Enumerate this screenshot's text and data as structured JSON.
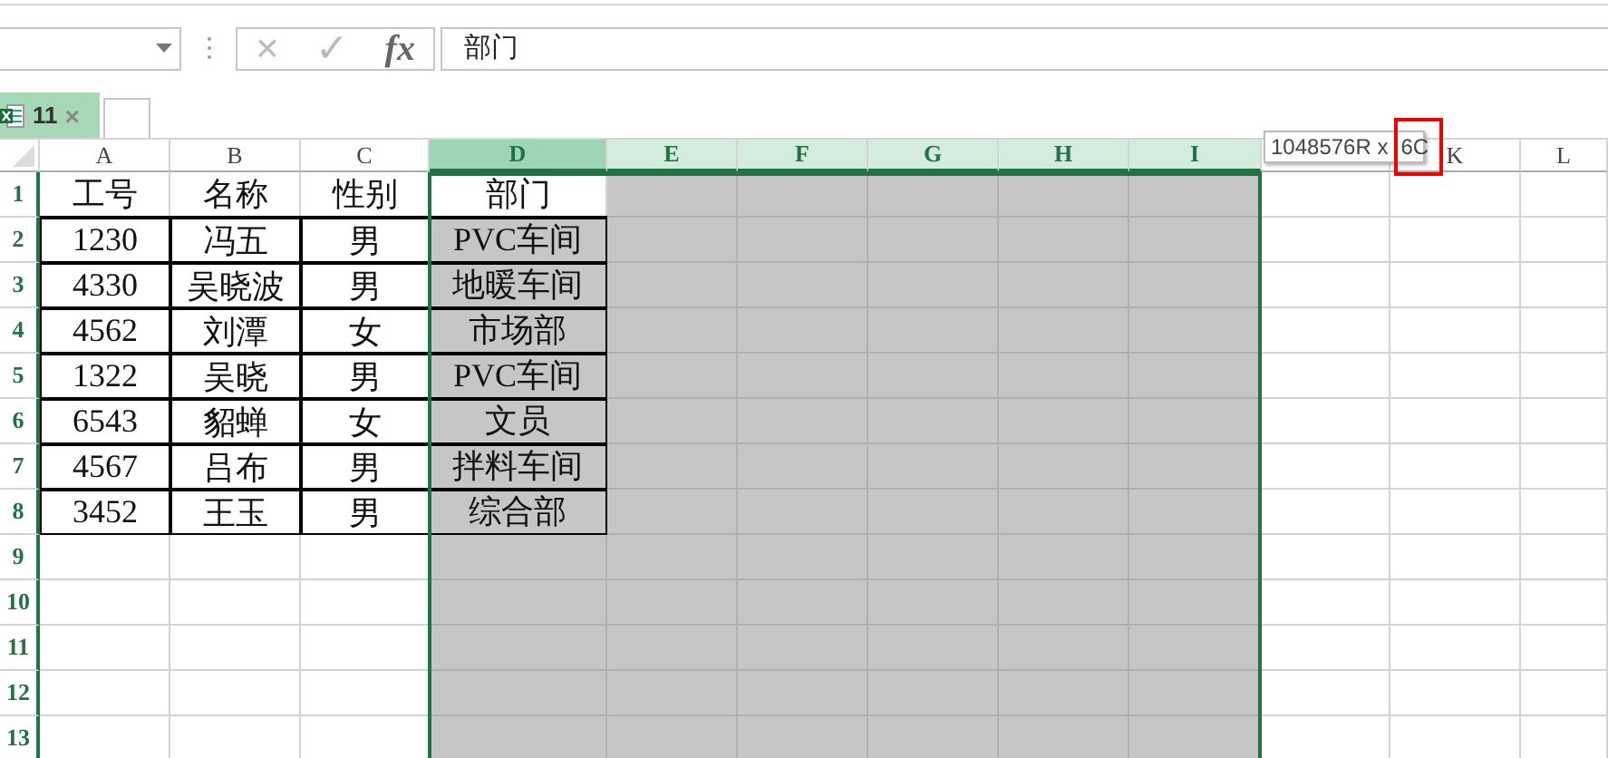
{
  "formula_bar": {
    "cancel_icon": "×",
    "enter_icon": "✓",
    "function_icon": "fx",
    "value": "部门"
  },
  "tabs": [
    {
      "label": "11",
      "close": "×",
      "selected": true
    }
  ],
  "columns": [
    {
      "label": "A",
      "selected": false,
      "active": false
    },
    {
      "label": "B",
      "selected": false,
      "active": false
    },
    {
      "label": "C",
      "selected": false,
      "active": false
    },
    {
      "label": "D",
      "selected": true,
      "active": true
    },
    {
      "label": "E",
      "selected": true,
      "active": false
    },
    {
      "label": "F",
      "selected": true,
      "active": false
    },
    {
      "label": "G",
      "selected": true,
      "active": false
    },
    {
      "label": "H",
      "selected": true,
      "active": false
    },
    {
      "label": "I",
      "selected": true,
      "active": false
    },
    {
      "selected": false,
      "active": false
    },
    {
      "label": "K",
      "selected": false,
      "active": false
    },
    {
      "label": "L",
      "selected": false,
      "active": false
    }
  ],
  "rows": [
    {
      "number": "1",
      "selected": true,
      "active": true,
      "cells": [
        "工号",
        "名称",
        "性别",
        "部门"
      ]
    },
    {
      "number": "2",
      "selected": true,
      "active": false,
      "cells": [
        "1230",
        "冯五",
        "男",
        "PVC车间"
      ]
    },
    {
      "number": "3",
      "selected": true,
      "active": false,
      "cells": [
        "4330",
        "吴晓波",
        "男",
        "地暖车间"
      ]
    },
    {
      "number": "4",
      "selected": true,
      "active": false,
      "cells": [
        "4562",
        "刘潭",
        "女",
        "市场部"
      ]
    },
    {
      "number": "5",
      "selected": true,
      "active": false,
      "cells": [
        "1322",
        "吴晓",
        "男",
        "PVC车间"
      ]
    },
    {
      "number": "6",
      "selected": true,
      "active": false,
      "cells": [
        "6543",
        "貂蝉",
        "女",
        "文员"
      ]
    },
    {
      "number": "7",
      "selected": true,
      "active": false,
      "cells": [
        "4567",
        "吕布",
        "男",
        "拌料车间"
      ]
    },
    {
      "number": "8",
      "selected": true,
      "active": false,
      "cells": [
        "3452",
        "王玉",
        "男",
        "综合部"
      ]
    },
    {
      "number": "9",
      "selected": true,
      "active": false,
      "cells": []
    },
    {
      "number": "10",
      "selected": true,
      "active": false,
      "cells": []
    },
    {
      "number": "11",
      "selected": true,
      "active": false,
      "cells": []
    },
    {
      "number": "12",
      "selected": true,
      "active": false,
      "cells": []
    },
    {
      "number": "13",
      "selected": true,
      "active": false,
      "cells": []
    }
  ],
  "tooltip": {
    "text": "1048576R x",
    "highlighted": "6C"
  }
}
